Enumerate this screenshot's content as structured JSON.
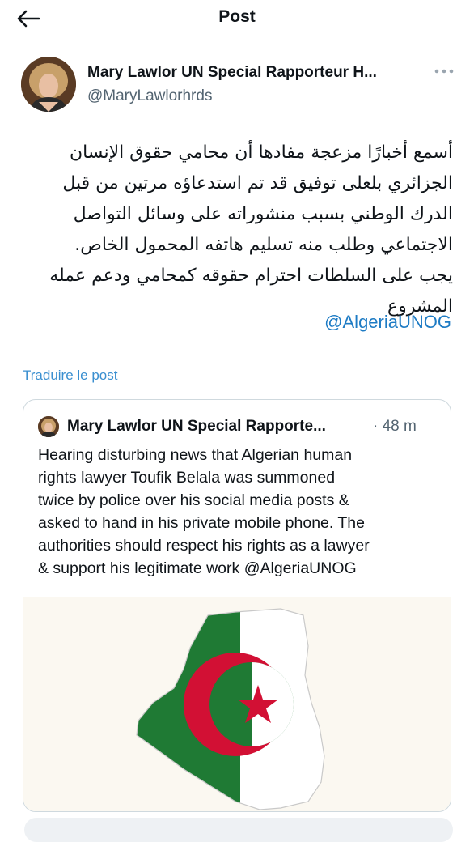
{
  "header": {
    "title": "Post"
  },
  "post": {
    "author_name": "Mary Lawlor UN Special Rapporteur H...",
    "author_handle": "@MaryLawlorhrds",
    "text_lines": [
      "أسمع أخبارًا مزعجة مفادها أن محامي حقوق الإنسان",
      "الجزائري بلعلى توفيق قد تم استدعاؤه مرتين من قبل",
      "الدرك الوطني بسبب منشوراته على وسائل التواصل",
      "الاجتماعي وطلب منه تسليم هاتفه المحمول الخاص.",
      "يجب على السلطات احترام حقوقه كمحامي ودعم عمله",
      "المشروع"
    ],
    "mention": "@AlgeriaUNOG",
    "translate_label": "Traduire le post"
  },
  "quoted_post": {
    "author_name": "Mary Lawlor UN Special Rapporte...",
    "time": "· 48 m",
    "text_lines": [
      "Hearing disturbing news that Algerian human",
      "rights lawyer Toufik Belala was summoned",
      "twice by police over his social media posts &",
      "asked to hand in his private mobile phone. The",
      "authorities should respect his rights as a lawyer",
      "& support his legitimate work @AlgeriaUNOG"
    ]
  },
  "colors": {
    "text": "#0f1419",
    "secondary": "#536471",
    "link": "#1d7bc4",
    "flag_green": "#1f7a34",
    "flag_red": "#d21034"
  },
  "icons": {
    "back": "arrow-left-icon",
    "more": "more-dots-icon"
  }
}
